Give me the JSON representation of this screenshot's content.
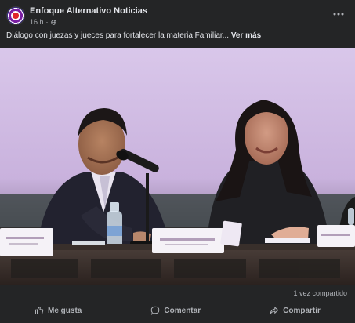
{
  "post": {
    "page_name": "Enfoque Alternativo Noticias",
    "time": "16 h",
    "separator": "·",
    "text": "Diálogo con juezas y jueces para fortalecer la materia Familiar...",
    "see_more": "Ver más",
    "shares": "1 vez compartido"
  },
  "actions": {
    "like": "Me gusta",
    "comment": "Comentar",
    "share": "Compartir"
  },
  "icons": {
    "avatar": "page-logo-avatar",
    "privacy": "globe-icon",
    "more": "more-options-icon",
    "like": "thumbs-up-icon",
    "comment": "comment-bubble-icon",
    "share": "share-arrow-icon"
  },
  "colors": {
    "background": "#242526",
    "text_primary": "#e4e6eb",
    "text_secondary": "#b0b3b8",
    "divider": "#3e4042"
  }
}
